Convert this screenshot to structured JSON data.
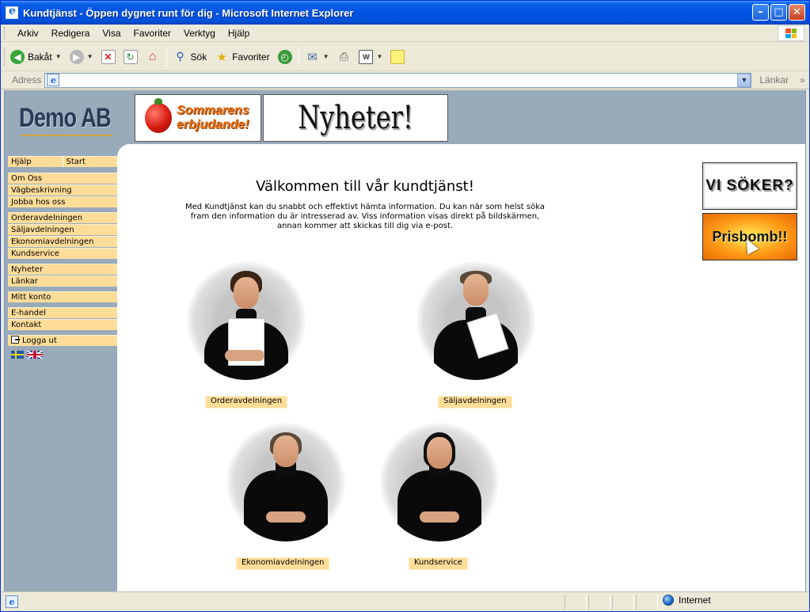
{
  "window": {
    "title": "Kundtjänst - Öppen dygnet runt för dig - Microsoft Internet Explorer"
  },
  "menubar": {
    "items": [
      "Arkiv",
      "Redigera",
      "Visa",
      "Favoriter",
      "Verktyg",
      "Hjälp"
    ]
  },
  "toolbar": {
    "back_label": "Bakåt",
    "search_label": "Sök",
    "favorites_label": "Favoriter"
  },
  "addressbar": {
    "label": "Adress",
    "value": "",
    "links_label": "Länkar"
  },
  "site": {
    "logo_text": "Demo AB",
    "banner_summer_line1": "Sommarens",
    "banner_summer_line2": "erbjudande!",
    "banner_news": "Nyheter!"
  },
  "nav": {
    "top_row": [
      "Hjälp",
      "Start"
    ],
    "group1": [
      "Om Oss",
      "Vägbeskrivning",
      "Jobba hos oss"
    ],
    "group2": [
      "Orderavdelningen",
      "Säljavdelningen",
      "Ekonomiavdelningen",
      "Kundservice"
    ],
    "group3": [
      "Nyheter",
      "Länkar"
    ],
    "group4": [
      "Mitt konto"
    ],
    "group5": [
      "E-handel",
      "Kontakt"
    ],
    "logout": "Logga ut"
  },
  "main": {
    "title": "Välkommen till vår kundtjänst!",
    "intro": "Med Kundtjänst kan du snabbt och effektivt hämta information. Du kan när som helst söka fram den information du är intresserad av. Viss information visas direkt på bildskärmen, annan kommer att skickas till dig via e-post.",
    "departments": [
      "Orderavdelningen",
      "Säljavdelningen",
      "Ekonomiavdelningen",
      "Kundservice"
    ]
  },
  "ads": {
    "jobs": "VI SÖKER?",
    "prisbomb": "Prisbomb!!"
  },
  "statusbar": {
    "text": "",
    "zone": "Internet"
  },
  "colors": {
    "nav_item_bg": "#ffdd99",
    "page_bg": "#99aabb",
    "content_bg": "#ffffff",
    "title_bar": "#0054e3"
  }
}
